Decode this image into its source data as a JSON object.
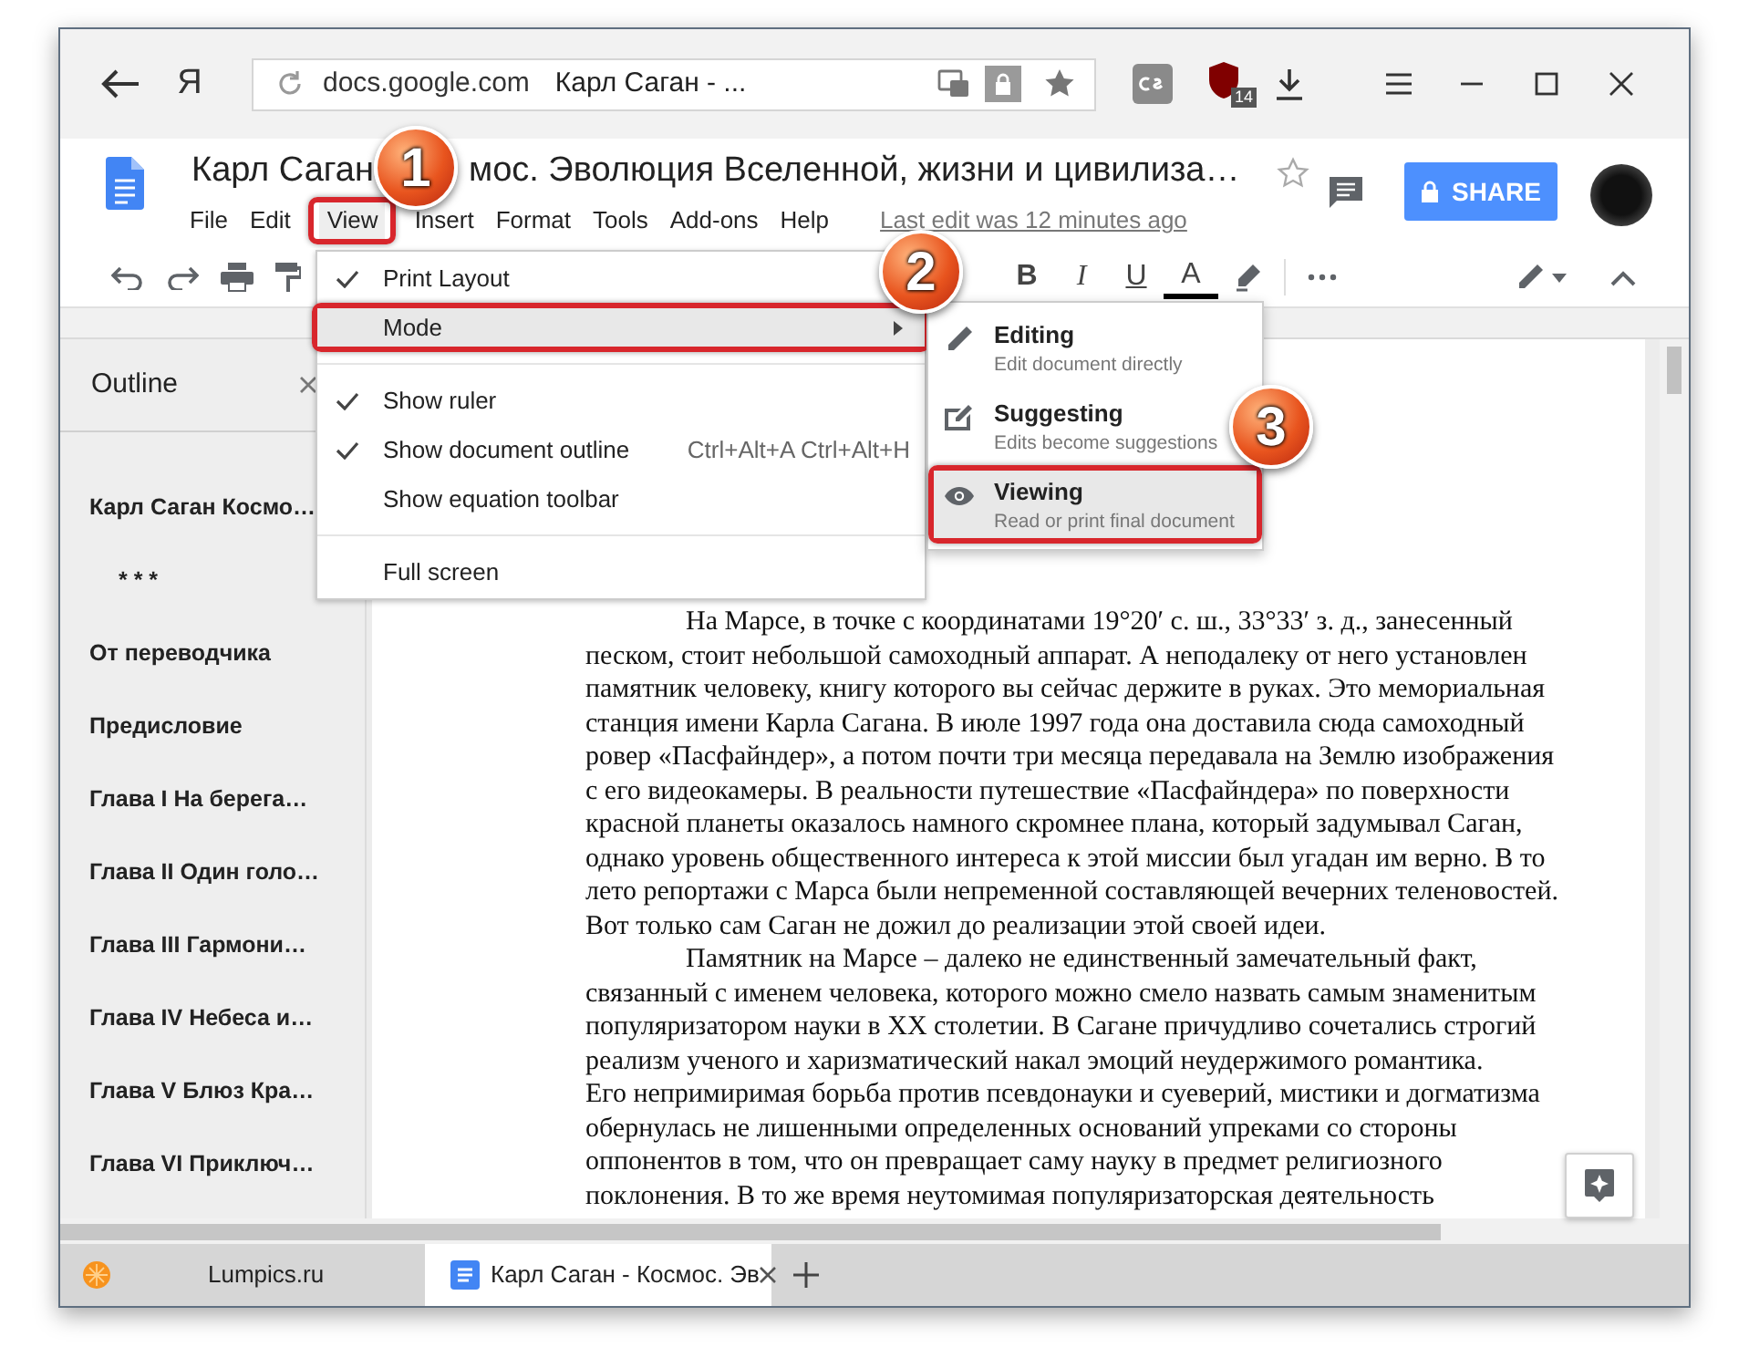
{
  "browser": {
    "yandex_button": "Я",
    "address": {
      "domain": "docs.google.com",
      "page_title": "Карл Саган - ..."
    },
    "extension_badge": "14",
    "tabs": [
      {
        "kind": "site",
        "label": "Lumpics.ru",
        "selected": false
      },
      {
        "kind": "docs",
        "label": "Карл Саган - Космос. Эв",
        "selected": true
      }
    ]
  },
  "docs": {
    "title_parts": [
      "Карл Саган",
      "мос. Эволюция Вселенной, жизни и цивилиза…"
    ],
    "menu": [
      {
        "label": "File",
        "selected": false
      },
      {
        "label": "Edit",
        "selected": false
      },
      {
        "label": "View",
        "selected": true
      },
      {
        "label": "Insert",
        "selected": false
      },
      {
        "label": "Format",
        "selected": false
      },
      {
        "label": "Tools",
        "selected": false
      },
      {
        "label": "Add-ons",
        "selected": false
      },
      {
        "label": "Help",
        "selected": false
      }
    ],
    "last_edit": "Last edit was 12 minutes ago",
    "share_button": "SHARE",
    "format_buttons": [
      "B",
      "I",
      "U",
      "A"
    ]
  },
  "outline": {
    "title": "Outline",
    "items": [
      {
        "label": "Карл Саган Космо…",
        "children": [
          {
            "label": "* * *"
          }
        ]
      },
      {
        "label": "От переводчика"
      },
      {
        "label": "Предисловие"
      },
      {
        "label": "Глава I На берега…"
      },
      {
        "label": "Глава II Один голо…"
      },
      {
        "label": "Глава III Гармони…"
      },
      {
        "label": "Глава IV Небеса и…"
      },
      {
        "label": "Глава V Блюз Кра…"
      },
      {
        "label": "Глава VI Приключ…"
      }
    ]
  },
  "document": {
    "paragraphs": [
      "На Марсе, в точке с координатами 19°20′ с. ш., 33°33′ з. д., занесенный\nпеском, стоит небольшой самоходный аппарат. А неподалеку от него установлен\nпамятник человеку, книгу которого вы сейчас держите в руках. Это мемориальная\nстанция имени Карла Сагана. В июле 1997 года она доставила сюда самоходный\nровер «Пасфайндер», а потом почти три месяца передавала на Землю изображения\nс его видеокамеры. В реальности путешествие «Пасфайндера» по поверхности\nкрасной планеты оказалось намного скромнее плана, который задумывал Саган,\nоднако уровень общественного интереса к этой миссии был угадан им верно. В то\nлето репортажи с Марса были непременной составляющей вечерних теленовостей.\nВот только сам Саган не дожил до реализации этой своей идеи.",
      "Памятник на Марсе – далеко не единственный замечательный факт,\nсвязанный с именем человека, которого можно смело назвать самым знаменитым\nпопуляризатором науки в XX столетии. В Сагане причудливо сочетались строгий\nреализм ученого и харизматический накал эмоций неудержимого романтика.\nЕго непримиримая борьба против псевдонауки и суеверий, мистики и догматизма\nобернулась не лишенными определенных оснований упреками со стороны\nоппонентов в том, что он превращает саму науку в предмет религиозного\nпоклонения. В то же время неутомимая популяризаторская деятельность"
    ]
  },
  "view_menu": [
    {
      "kind": "option",
      "label": "Print Layout",
      "checked": true
    },
    {
      "kind": "submenu",
      "label": "Mode",
      "selected": true
    },
    {
      "kind": "divider"
    },
    {
      "kind": "option",
      "label": "Show ruler",
      "checked": true
    },
    {
      "kind": "option",
      "label": "Show document outline",
      "checked": true,
      "shortcut": "Ctrl+Alt+A Ctrl+Alt+H"
    },
    {
      "kind": "option",
      "label": "Show equation toolbar",
      "checked": false
    },
    {
      "kind": "divider"
    },
    {
      "kind": "option",
      "label": "Full screen",
      "checked": false
    }
  ],
  "mode_submenu": [
    {
      "kind": "editing",
      "label": "Editing",
      "description": "Edit document directly",
      "selected": false
    },
    {
      "kind": "suggesting",
      "label": "Suggesting",
      "description": "Edits become suggestions",
      "selected": false
    },
    {
      "kind": "viewing",
      "label": "Viewing",
      "description": "Read or print final document",
      "selected": true
    }
  ],
  "callouts": [
    "1",
    "2",
    "3"
  ]
}
